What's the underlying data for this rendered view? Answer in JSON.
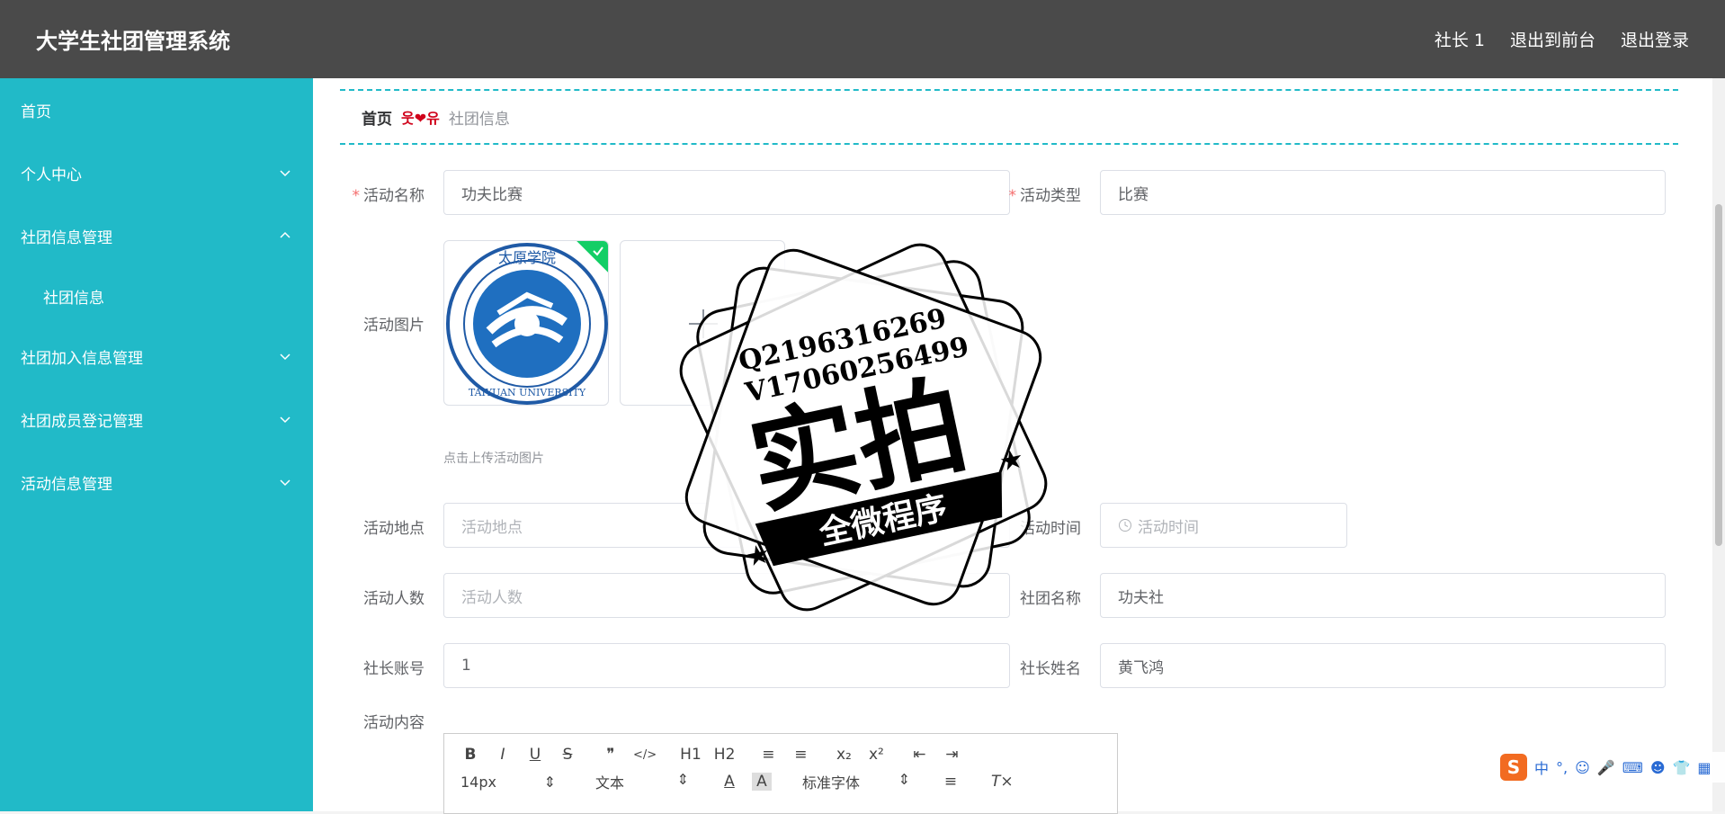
{
  "header": {
    "title": "大学生社团管理系统",
    "user": "社长 1",
    "to_front": "退出到前台",
    "logout": "退出登录"
  },
  "sidebar": {
    "items": [
      {
        "label": "首页"
      },
      {
        "label": "个人中心"
      },
      {
        "label": "社团信息管理"
      },
      {
        "label": "社团信息"
      },
      {
        "label": "社团加入信息管理"
      },
      {
        "label": "社团成员登记管理"
      },
      {
        "label": "活动信息管理"
      }
    ]
  },
  "breadcrumb": {
    "home": "首页",
    "separator": "웃❤유",
    "current": "社团信息"
  },
  "form": {
    "name_label": "活动名称",
    "name_value": "功夫比赛",
    "type_label": "活动类型",
    "type_value": "比赛",
    "image_label": "活动图片",
    "image_hint": "点击上传活动图片",
    "place_label": "活动地点",
    "place_placeholder": "活动地点",
    "time_label": "活动时间",
    "time_placeholder": "活动时间",
    "count_label": "活动人数",
    "count_placeholder": "活动人数",
    "club_label": "社团名称",
    "club_value": "功夫社",
    "leader_acc_label": "社长账号",
    "leader_acc_value": "1",
    "leader_name_label": "社长姓名",
    "leader_name_value": "黄飞鸿",
    "content_label": "活动内容"
  },
  "editor": {
    "font_size": "14px",
    "text_type": "文本",
    "font_family": "标准字体",
    "buttons": [
      "B",
      "I",
      "U",
      "S",
      "❞",
      "</>",
      "H1",
      "H2",
      "≡",
      "≡",
      "x₂",
      "x²",
      "⇤",
      "⇥"
    ]
  },
  "logo": {
    "top_text": "太原学院",
    "bottom_text": "TAIYUAN UNIVERSITY"
  },
  "stamp": {
    "line1": "Q2196316269",
    "line2": "V17060256499",
    "main": "实拍",
    "banner": "全微程序"
  },
  "ime": {
    "lang": "中",
    "punct": "°,"
  },
  "colors": {
    "header_bg": "#4a4a4a",
    "sidebar_bg": "#21bac8",
    "accent": "#21bac8",
    "required": "#f56c6c"
  }
}
